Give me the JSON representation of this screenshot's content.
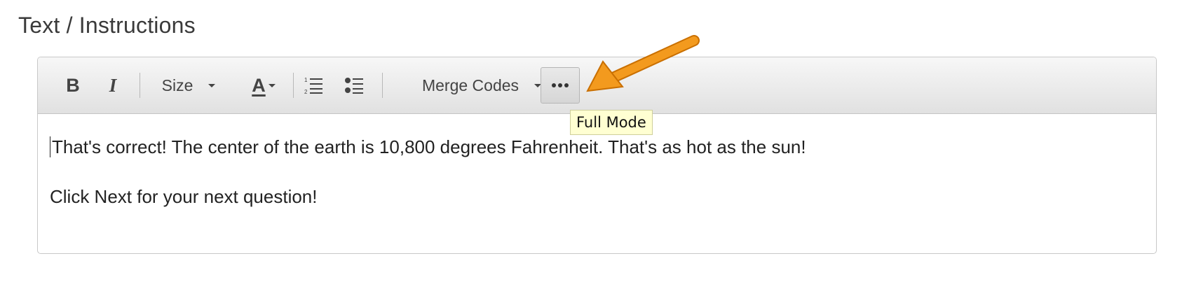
{
  "section": {
    "title": "Text / Instructions"
  },
  "toolbar": {
    "bold_icon": "B",
    "italic_icon": "I",
    "size_label": "Size",
    "color_icon": "A",
    "merge_codes_label": "Merge Codes",
    "more_icon": "more-dots-icon"
  },
  "tooltip": {
    "text": "Full Mode"
  },
  "content": {
    "paragraph1": "That's correct! The center of the earth is 10,800 degrees Fahrenheit. That's as hot as the sun!",
    "paragraph2": "Click Next for your next question!"
  },
  "colors": {
    "arrow": "#f39a1e",
    "tooltip_bg": "#ffffd2"
  }
}
